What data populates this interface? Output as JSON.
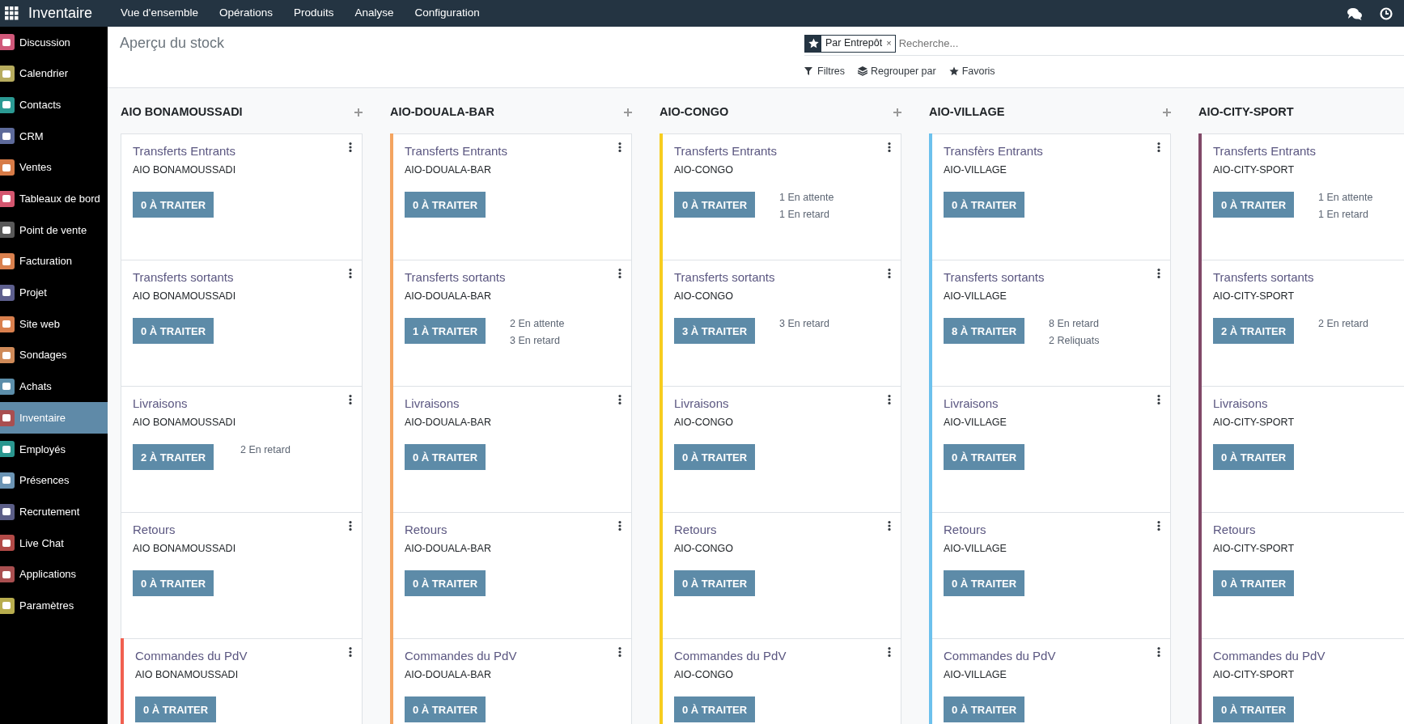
{
  "navbar": {
    "app_name": "Inventaire",
    "menus": [
      "Vue d'ensemble",
      "Opérations",
      "Produits",
      "Analyse",
      "Configuration"
    ]
  },
  "sidebar": {
    "items": [
      {
        "label": "Discussion",
        "color": "#d0587a",
        "selected": false
      },
      {
        "label": "Calendrier",
        "color": "#b7ac5e",
        "selected": false
      },
      {
        "label": "Contacts",
        "color": "#2b9a93",
        "selected": false
      },
      {
        "label": "CRM",
        "color": "#5d6a9a",
        "selected": false
      },
      {
        "label": "Ventes",
        "color": "#d77b47",
        "selected": false
      },
      {
        "label": "Tableaux de bord",
        "color": "#d4566f",
        "selected": false
      },
      {
        "label": "Point de vente",
        "color": "#595959",
        "selected": false
      },
      {
        "label": "Facturation",
        "color": "#d9804e",
        "selected": false
      },
      {
        "label": "Projet",
        "color": "#5d5f8e",
        "selected": false
      },
      {
        "label": "Site web",
        "color": "#d9804e",
        "selected": false
      },
      {
        "label": "Sondages",
        "color": "#cf8a58",
        "selected": false
      },
      {
        "label": "Achats",
        "color": "#5c8eaa",
        "selected": false
      },
      {
        "label": "Inventaire",
        "color": "#a94f50",
        "selected": true
      },
      {
        "label": "Employés",
        "color": "#2a978f",
        "selected": false
      },
      {
        "label": "Présences",
        "color": "#6b94b4",
        "selected": false
      },
      {
        "label": "Recrutement",
        "color": "#5b5e87",
        "selected": false
      },
      {
        "label": "Live Chat",
        "color": "#b24a47",
        "selected": false
      },
      {
        "label": "Applications",
        "color": "#a94f50",
        "selected": false
      },
      {
        "label": "Paramètres",
        "color": "#b8ad4e",
        "selected": false
      }
    ]
  },
  "control_panel": {
    "title": "Aperçu du stock",
    "facet": {
      "label": "Par Entrepôt",
      "remove": "×"
    },
    "search": {
      "placeholder": "Recherche..."
    },
    "filters": [
      {
        "label": "Filtres",
        "kind": "filter"
      },
      {
        "label": "Regrouper par",
        "kind": "group"
      },
      {
        "label": "Favoris",
        "kind": "favorite"
      }
    ]
  },
  "columns": [
    {
      "title": "AIO BONAMOUSSADI",
      "add_button": true,
      "cards": [
        {
          "title": "Transferts Entrants",
          "warehouse": "AIO BONAMOUSSADI",
          "button": "0 À TRAITER",
          "menu": true
        },
        {
          "title": "Transferts sortants",
          "warehouse": "AIO BONAMOUSSADI",
          "button": "0 À TRAITER",
          "menu": true
        },
        {
          "title": "Livraisons",
          "warehouse": "AIO BONAMOUSSADI",
          "button": "2 À TRAITER",
          "stats": [
            "2 En retard"
          ],
          "menu": true
        },
        {
          "title": "Retours",
          "warehouse": "AIO BONAMOUSSADI",
          "button": "0 À TRAITER",
          "menu": true
        },
        {
          "title": "Commandes du PdV",
          "warehouse": "AIO BONAMOUSSADI",
          "button": "0 À TRAITER",
          "menu": true,
          "color": "#f06050"
        }
      ]
    },
    {
      "title": "AIO-DOUALA-BAR",
      "add_button": true,
      "cards": [
        {
          "title": "Transferts Entrants",
          "warehouse": "AIO-DOUALA-BAR",
          "button": "0 À TRAITER",
          "menu": true,
          "color": "#f4a460"
        },
        {
          "title": "Transferts sortants",
          "warehouse": "AIO-DOUALA-BAR",
          "button": "1 À TRAITER",
          "stats": [
            "2 En attente",
            "3 En retard"
          ],
          "menu": true,
          "color": "#f4a460"
        },
        {
          "title": "Livraisons",
          "warehouse": "AIO-DOUALA-BAR",
          "button": "0 À TRAITER",
          "menu": true,
          "color": "#f4a460"
        },
        {
          "title": "Retours",
          "warehouse": "AIO-DOUALA-BAR",
          "button": "0 À TRAITER",
          "menu": true,
          "color": "#f4a460"
        },
        {
          "title": "Commandes du PdV",
          "warehouse": "AIO-DOUALA-BAR",
          "button": "0 À TRAITER",
          "menu": true,
          "color": "#f4a460"
        }
      ]
    },
    {
      "title": "AIO-CONGO",
      "add_button": true,
      "cards": [
        {
          "title": "Transferts Entrants",
          "warehouse": "AIO-CONGO",
          "button": "0 À TRAITER",
          "stats": [
            "1 En attente",
            "1 En retard"
          ],
          "menu": true,
          "color": "#f7cd1f"
        },
        {
          "title": "Transferts sortants",
          "warehouse": "AIO-CONGO",
          "button": "3 À TRAITER",
          "stats": [
            "3 En retard"
          ],
          "menu": true,
          "color": "#f7cd1f"
        },
        {
          "title": "Livraisons",
          "warehouse": "AIO-CONGO",
          "button": "0 À TRAITER",
          "menu": true,
          "color": "#f7cd1f"
        },
        {
          "title": "Retours",
          "warehouse": "AIO-CONGO",
          "button": "0 À TRAITER",
          "menu": true,
          "color": "#f7cd1f"
        },
        {
          "title": "Commandes du PdV",
          "warehouse": "AIO-CONGO",
          "button": "0 À TRAITER",
          "menu": true,
          "color": "#f7cd1f"
        }
      ]
    },
    {
      "title": "AIO-VILLAGE",
      "add_button": true,
      "cards": [
        {
          "title": "Transfèrs Entrants",
          "warehouse": "AIO-VILLAGE",
          "button": "0 À TRAITER",
          "menu": true,
          "color": "#6cc1ed"
        },
        {
          "title": "Transferts sortants",
          "warehouse": "AIO-VILLAGE",
          "button": "8 À TRAITER",
          "stats": [
            "8 En retard",
            "2 Reliquats"
          ],
          "menu": true,
          "color": "#6cc1ed"
        },
        {
          "title": "Livraisons",
          "warehouse": "AIO-VILLAGE",
          "button": "0 À TRAITER",
          "menu": true,
          "color": "#6cc1ed"
        },
        {
          "title": "Retours",
          "warehouse": "AIO-VILLAGE",
          "button": "0 À TRAITER",
          "menu": true,
          "color": "#6cc1ed"
        },
        {
          "title": "Commandes du PdV",
          "warehouse": "AIO-VILLAGE",
          "button": "0 À TRAITER",
          "menu": true,
          "color": "#6cc1ed"
        }
      ]
    },
    {
      "title": "AIO-CITY-SPORT",
      "add_button": false,
      "cards": [
        {
          "title": "Transferts Entrants",
          "warehouse": "AIO-CITY-SPORT",
          "button": "0 À TRAITER",
          "stats": [
            "1 En attente",
            "1 En retard"
          ],
          "menu": false,
          "color": "#814968"
        },
        {
          "title": "Transferts sortants",
          "warehouse": "AIO-CITY-SPORT",
          "button": "2 À TRAITER",
          "stats": [
            "2 En retard"
          ],
          "menu": false,
          "color": "#814968"
        },
        {
          "title": "Livraisons",
          "warehouse": "AIO-CITY-SPORT",
          "button": "0 À TRAITER",
          "menu": false,
          "color": "#814968"
        },
        {
          "title": "Retours",
          "warehouse": "AIO-CITY-SPORT",
          "button": "0 À TRAITER",
          "menu": false,
          "color": "#814968"
        },
        {
          "title": "Commandes du PdV",
          "warehouse": "AIO-CITY-SPORT",
          "button": "0 À TRAITER",
          "menu": false,
          "color": "#814968"
        }
      ]
    }
  ]
}
